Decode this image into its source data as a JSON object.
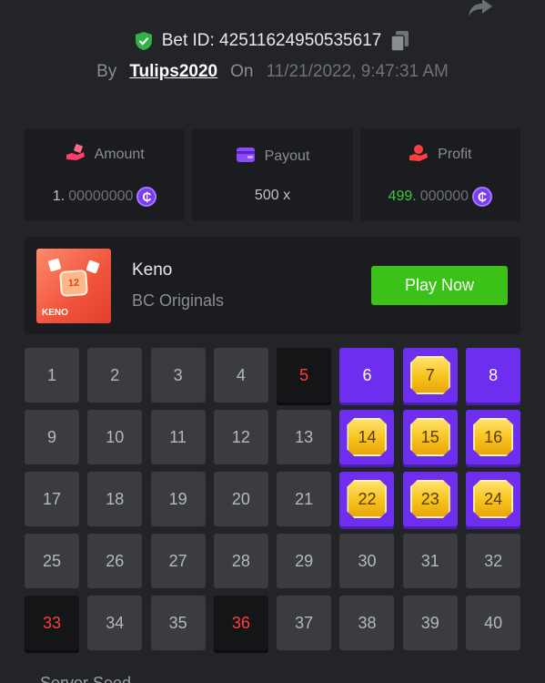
{
  "header": {
    "bet_id_label": "Bet ID: 42511624950535617",
    "by_label": "By",
    "username": "Tulips2020",
    "on_label": "On",
    "datetime": "11/21/2022, 9:47:31 AM"
  },
  "stats": {
    "amount": {
      "label": "Amount",
      "value_lead": "1.",
      "value_rest": "00000000",
      "icon": "hand-coins-icon",
      "icon_color": "#ff3e6c"
    },
    "payout": {
      "label": "Payout",
      "value": "500 x",
      "icon": "wallet-icon",
      "icon_color": "#8b4cf7"
    },
    "profit": {
      "label": "Profit",
      "value_lead": "499.",
      "value_rest": "000000",
      "icon": "hand-money-icon",
      "icon_color": "#ff3e3e"
    },
    "coin_symbol": "₵"
  },
  "game": {
    "title": "Keno",
    "subtitle": "BC Originals",
    "play_label": "Play Now",
    "thumb_number": "12",
    "thumb_label": "KENO"
  },
  "grid": {
    "cells": [
      {
        "n": "1",
        "s": "normal"
      },
      {
        "n": "2",
        "s": "normal"
      },
      {
        "n": "3",
        "s": "normal"
      },
      {
        "n": "4",
        "s": "normal"
      },
      {
        "n": "5",
        "s": "miss"
      },
      {
        "n": "6",
        "s": "pick"
      },
      {
        "n": "7",
        "s": "hit"
      },
      {
        "n": "8",
        "s": "pick"
      },
      {
        "n": "9",
        "s": "normal"
      },
      {
        "n": "10",
        "s": "normal"
      },
      {
        "n": "11",
        "s": "normal"
      },
      {
        "n": "12",
        "s": "normal"
      },
      {
        "n": "13",
        "s": "normal"
      },
      {
        "n": "14",
        "s": "hit"
      },
      {
        "n": "15",
        "s": "hit"
      },
      {
        "n": "16",
        "s": "hit"
      },
      {
        "n": "17",
        "s": "normal"
      },
      {
        "n": "18",
        "s": "normal"
      },
      {
        "n": "19",
        "s": "normal"
      },
      {
        "n": "20",
        "s": "normal"
      },
      {
        "n": "21",
        "s": "normal"
      },
      {
        "n": "22",
        "s": "hit"
      },
      {
        "n": "23",
        "s": "hit"
      },
      {
        "n": "24",
        "s": "hit"
      },
      {
        "n": "25",
        "s": "normal"
      },
      {
        "n": "26",
        "s": "normal"
      },
      {
        "n": "27",
        "s": "normal"
      },
      {
        "n": "28",
        "s": "normal"
      },
      {
        "n": "29",
        "s": "normal"
      },
      {
        "n": "30",
        "s": "normal"
      },
      {
        "n": "31",
        "s": "normal"
      },
      {
        "n": "32",
        "s": "normal"
      },
      {
        "n": "33",
        "s": "miss"
      },
      {
        "n": "34",
        "s": "normal"
      },
      {
        "n": "35",
        "s": "normal"
      },
      {
        "n": "36",
        "s": "miss"
      },
      {
        "n": "37",
        "s": "normal"
      },
      {
        "n": "38",
        "s": "normal"
      },
      {
        "n": "39",
        "s": "normal"
      },
      {
        "n": "40",
        "s": "normal"
      }
    ]
  },
  "footer": {
    "label": "Server Seed"
  },
  "colors": {
    "background": "#232427",
    "card": "#1b1c1f",
    "accent_purple": "#6d2ef0",
    "play_green": "#3bc117",
    "profit_green": "#3fc73a",
    "miss_red": "#ff3d3d"
  }
}
